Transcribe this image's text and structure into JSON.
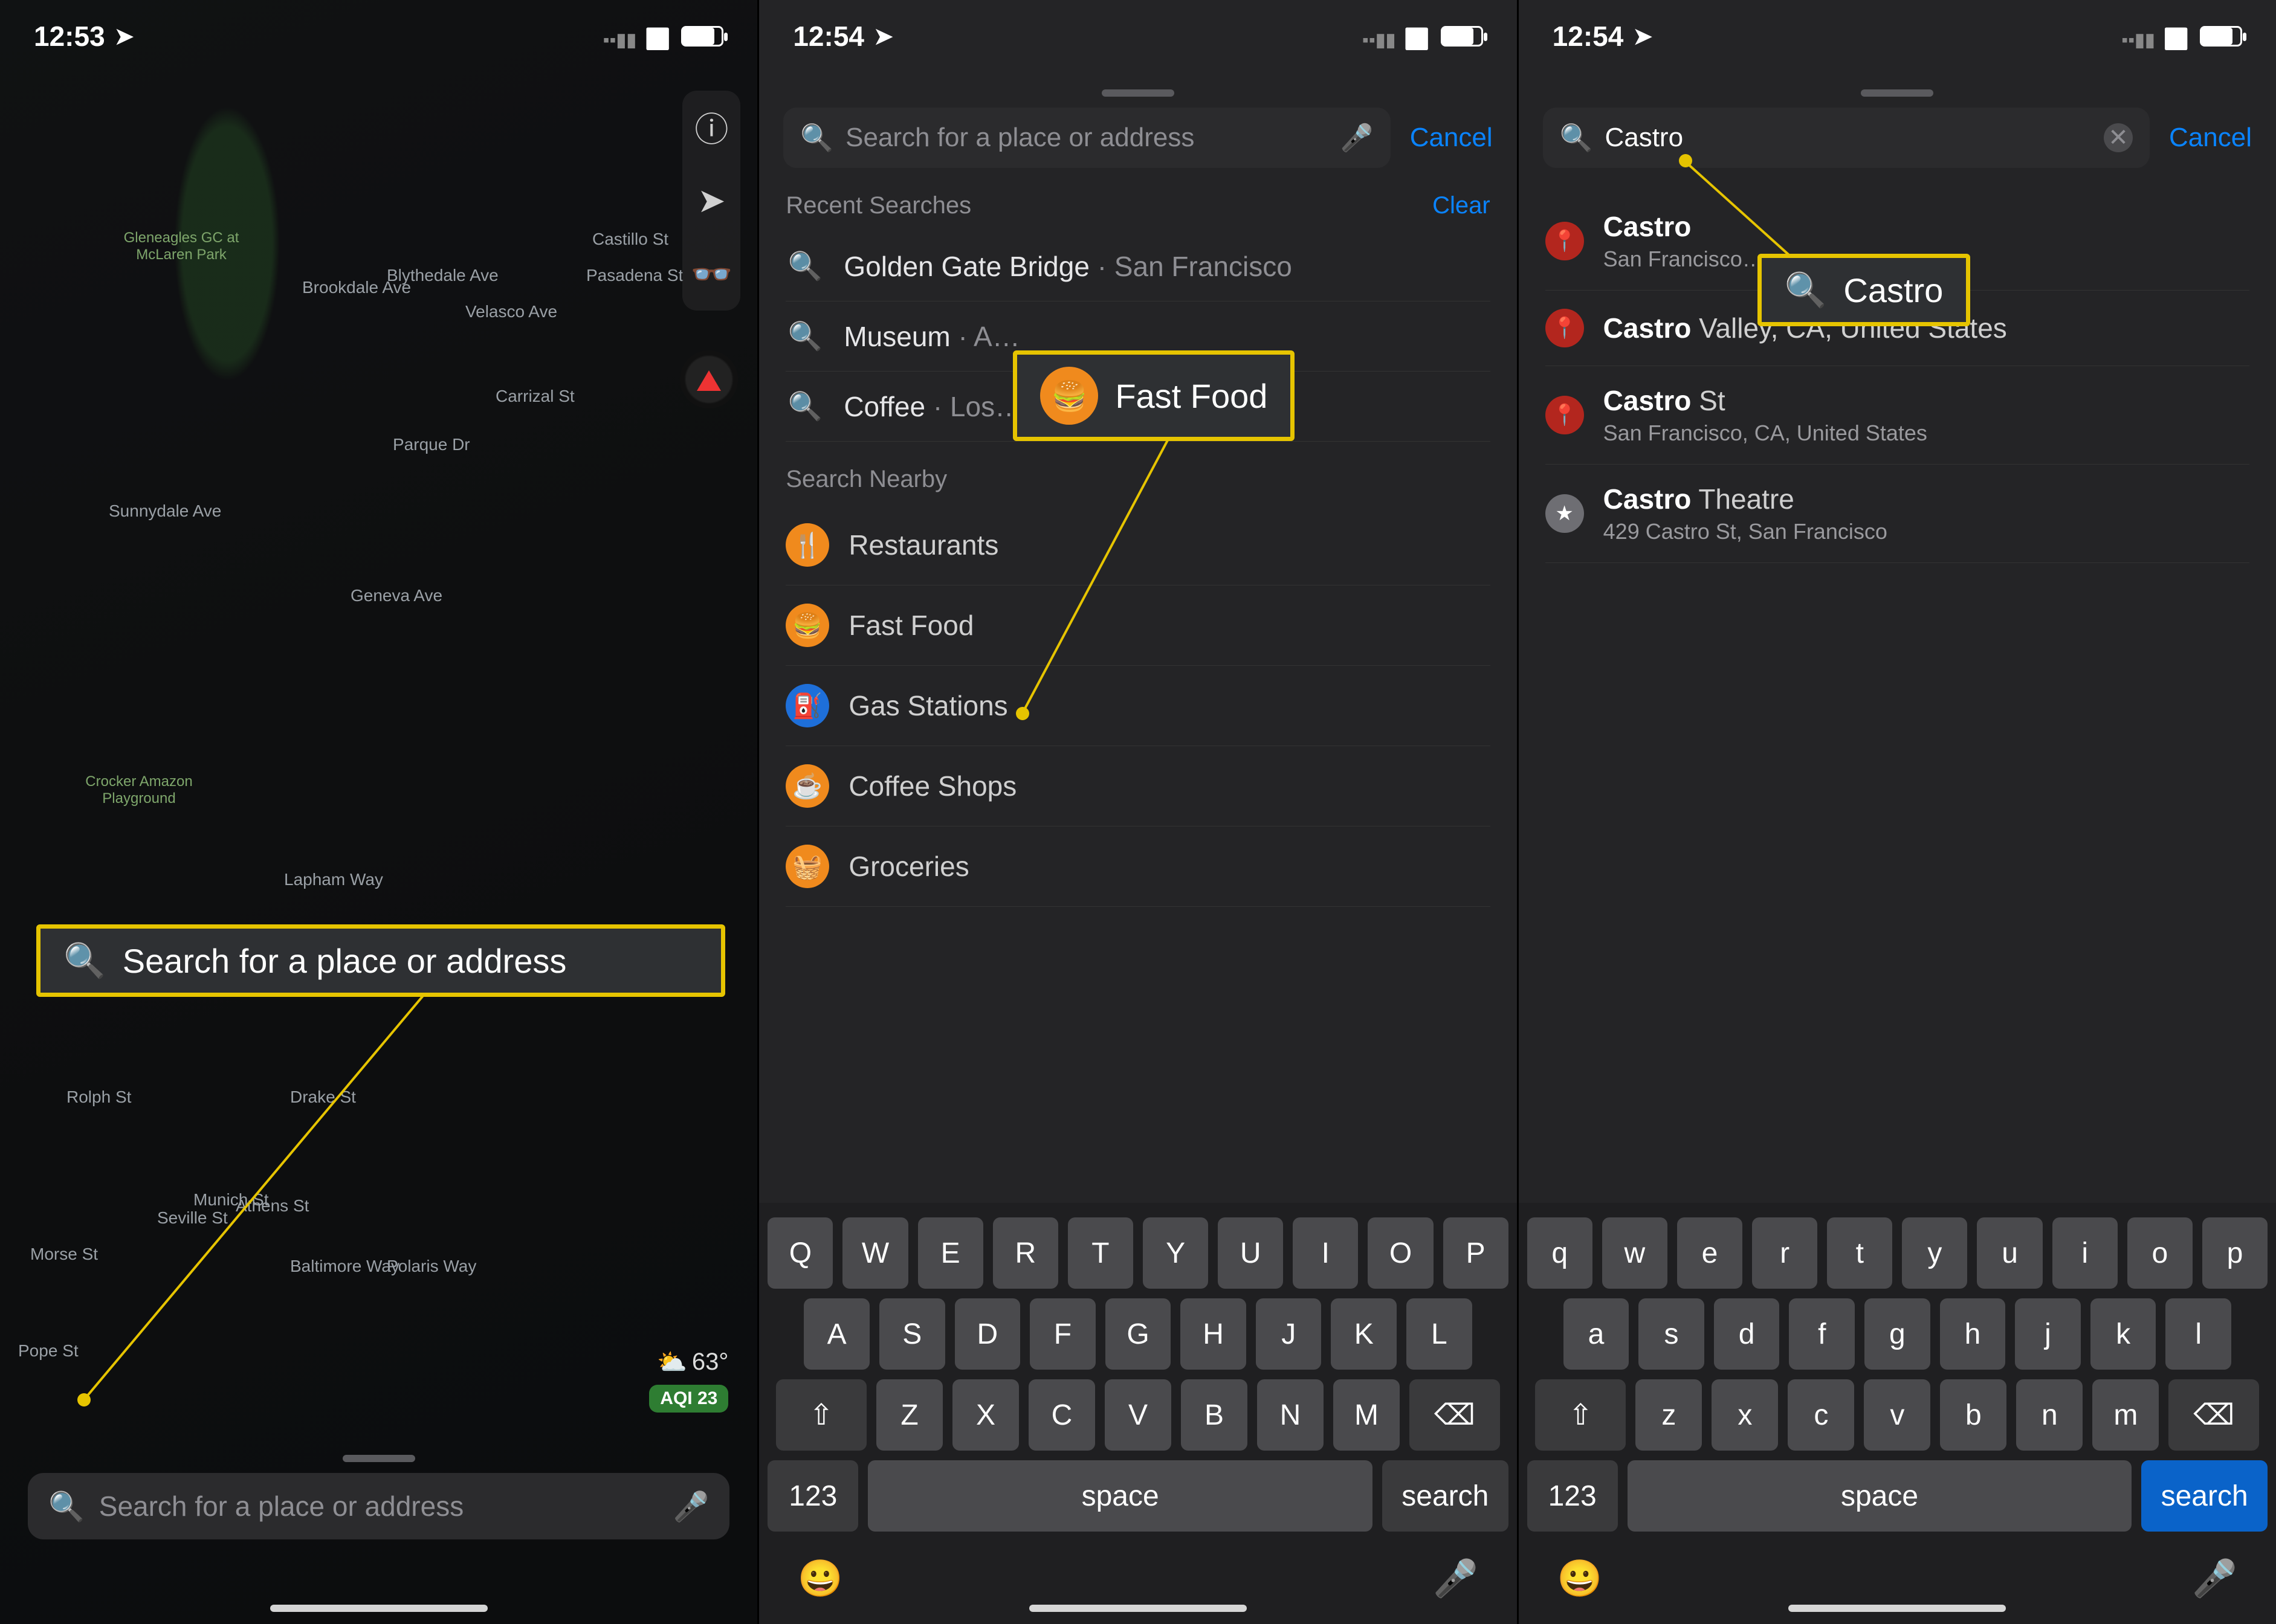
{
  "panel1": {
    "time": "12:53",
    "search_placeholder": "Search for a place or address",
    "weather_temp": "63°",
    "aqi_label": "AQI 23",
    "callout_text": "Search for a place or address",
    "map_labels": [
      "Gleneagles GC at McLaren Park",
      "Crocker Amazon Playground",
      "Sunnydale Ave",
      "Geneva Ave",
      "Blythedale Ave",
      "Velasco Ave",
      "Brookdale Ave",
      "Carrizal St",
      "Parque Dr",
      "Castillo St",
      "Pasadena St",
      "Lapham Way",
      "Drake St",
      "Rolph St",
      "Munich St",
      "Baltimore Way",
      "Polaris Way",
      "Morse St",
      "Seville St",
      "Athens St",
      "Pope St"
    ]
  },
  "panel2": {
    "time": "12:54",
    "search_placeholder": "Search for a place or address",
    "cancel": "Cancel",
    "recent_header": "Recent Searches",
    "clear": "Clear",
    "recent": [
      {
        "title": "Golden Gate Bridge",
        "sub": "San Francisco"
      },
      {
        "title": "Museum",
        "sub": "A…"
      },
      {
        "title": "Coffee",
        "sub": "Los…"
      }
    ],
    "nearby_header": "Search Nearby",
    "nearby": [
      {
        "label": "Restaurants",
        "color": "#f08a1d",
        "glyph": "🍴"
      },
      {
        "label": "Fast Food",
        "color": "#f08a1d",
        "glyph": "🍔"
      },
      {
        "label": "Gas Stations",
        "color": "#1e6fd9",
        "glyph": "⛽"
      },
      {
        "label": "Coffee Shops",
        "color": "#f08a1d",
        "glyph": "☕"
      },
      {
        "label": "Groceries",
        "color": "#f08a1d",
        "glyph": "🧺"
      }
    ],
    "callout_text": "Fast Food",
    "keyboard": {
      "rows": [
        [
          "Q",
          "W",
          "E",
          "R",
          "T",
          "Y",
          "U",
          "I",
          "O",
          "P"
        ],
        [
          "A",
          "S",
          "D",
          "F",
          "G",
          "H",
          "J",
          "K",
          "L"
        ],
        [
          "⇧",
          "Z",
          "X",
          "C",
          "V",
          "B",
          "N",
          "M",
          "⌫"
        ]
      ],
      "num_key": "123",
      "space": "space",
      "search": "search"
    }
  },
  "panel3": {
    "time": "12:54",
    "search_value": "Castro",
    "cancel": "Cancel",
    "results": [
      {
        "kind": "pin",
        "title_bold": "Castro",
        "title_rest": "",
        "meta": "San Francisco…"
      },
      {
        "kind": "pin",
        "title_bold": "Castro",
        "title_rest": " Valley, CA, United States",
        "meta": ""
      },
      {
        "kind": "pin",
        "title_bold": "Castro",
        "title_rest": " St",
        "meta": "San Francisco, CA, United States"
      },
      {
        "kind": "star",
        "title_bold": "Castro",
        "title_rest": " Theatre",
        "meta": "429 Castro St, San Francisco"
      }
    ],
    "callout_text": "Castro",
    "keyboard": {
      "rows": [
        [
          "q",
          "w",
          "e",
          "r",
          "t",
          "y",
          "u",
          "i",
          "o",
          "p"
        ],
        [
          "a",
          "s",
          "d",
          "f",
          "g",
          "h",
          "j",
          "k",
          "l"
        ],
        [
          "⇧",
          "z",
          "x",
          "c",
          "v",
          "b",
          "n",
          "m",
          "⌫"
        ]
      ],
      "num_key": "123",
      "space": "space",
      "search": "search",
      "search_blue": true
    }
  }
}
